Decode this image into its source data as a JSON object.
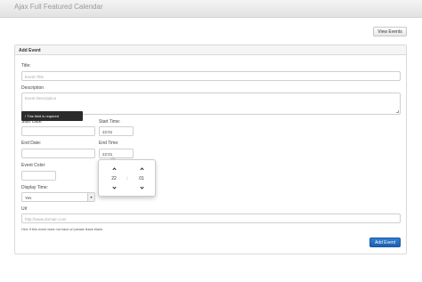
{
  "app": {
    "title": "Ajax Full Featured Calendar"
  },
  "toolbar": {
    "view_events_label": "View Events"
  },
  "form": {
    "panel_title": "Add Event",
    "title_label": "Title:",
    "title_placeholder": "Event Title",
    "description_label": "Description",
    "description_placeholder": "Event Description",
    "tooltip_text": "! This field is required",
    "start_date_label": "Start Date:",
    "start_time_label": "Start Time:",
    "start_time_value": "22:01",
    "end_date_label": "End Date:",
    "end_time_label": "End Time:",
    "end_time_value": "22:01",
    "event_color_label": "Event Color:",
    "display_time_label": "Display Time:",
    "display_time_value": "Yes",
    "url_label": "Url",
    "url_placeholder": "http://www.domain.com",
    "url_hint": "Hint: If this event does not have url please leave blank",
    "submit_label": "Add Event"
  },
  "timepicker": {
    "hour": "22",
    "separator": ":",
    "minute": "01"
  }
}
